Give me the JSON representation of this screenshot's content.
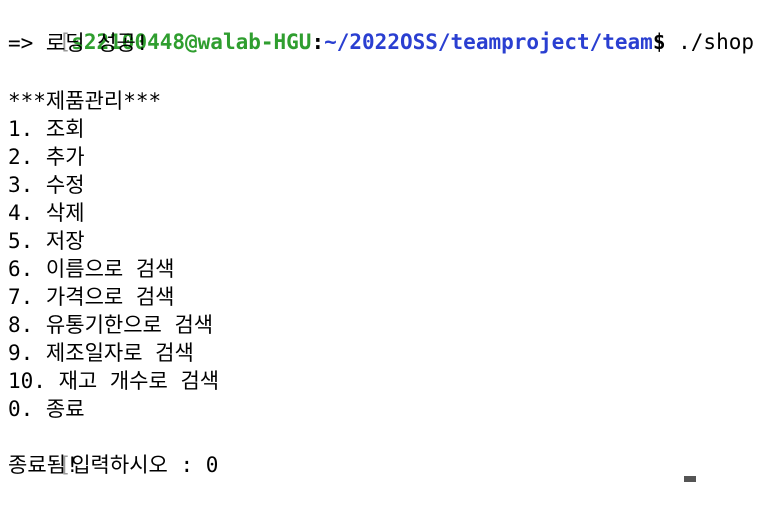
{
  "prompt": {
    "bracket": "[",
    "user_host": "s22100448@walab-HGU",
    "colon": ":",
    "path": "~/2022OSS/teamproject/team",
    "symbol": "$",
    "command": " ./shop"
  },
  "output": {
    "loading": "=> 로딩 성공!",
    "menu_title": "***제품관리***",
    "menu_items": [
      "1. 조회",
      "2. 추가",
      "3. 수정",
      "4. 삭제",
      "5. 저장",
      "6. 이름으로 검색",
      "7. 가격으로 검색",
      "8. 유통기한으로 검색",
      "9. 제조일자로 검색",
      "10. 재고 개수로 검색",
      "0. 종료"
    ],
    "input_bracket": "[",
    "input_prompt": "입력하시오 : 0",
    "exit_message": "종료됨!"
  },
  "colors": {
    "user_host": "#2f9e2f",
    "path": "#2a3fd1",
    "background": "#ffffff",
    "text": "#000000"
  }
}
